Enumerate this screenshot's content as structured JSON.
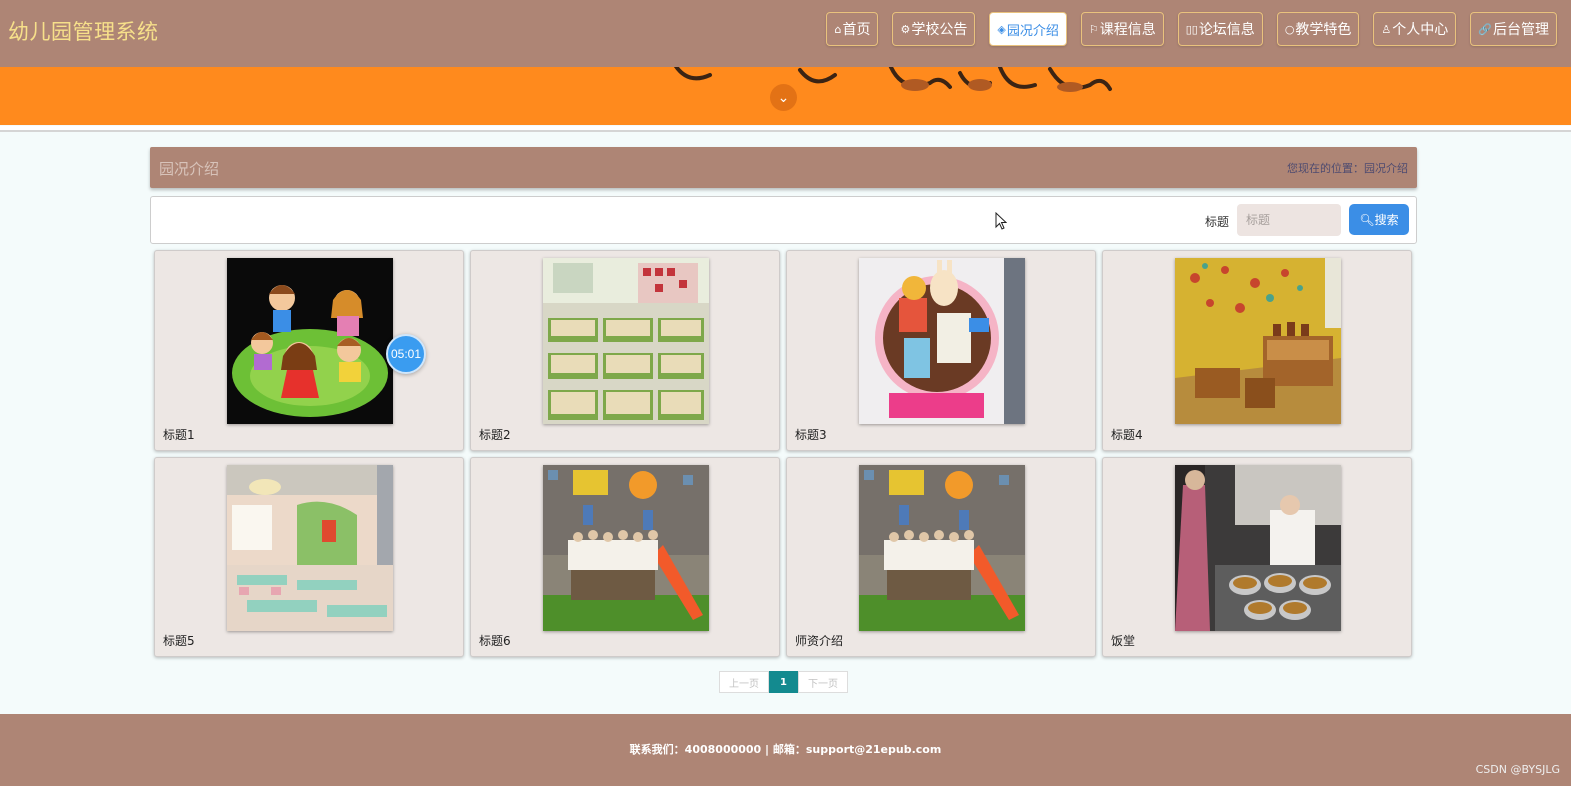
{
  "brand": "幼儿园管理系统",
  "nav": [
    {
      "icon": "home-icon",
      "glyph": "⌂",
      "label": "首页"
    },
    {
      "icon": "gear-icon",
      "glyph": "⚙",
      "label": "学校公告"
    },
    {
      "icon": "layers-icon",
      "glyph": "◈",
      "label": "园况介绍"
    },
    {
      "icon": "flag-icon",
      "glyph": "⚐",
      "label": "课程信息"
    },
    {
      "icon": "chat-icon",
      "glyph": "▯▯",
      "label": "论坛信息"
    },
    {
      "icon": "circle-icon",
      "glyph": "○",
      "label": "教学特色"
    },
    {
      "icon": "user-icon",
      "glyph": "♙",
      "label": "个人中心"
    },
    {
      "icon": "link-icon",
      "glyph": "🔗",
      "label": "后台管理"
    }
  ],
  "active_nav": "园况介绍",
  "page_title": "园况介绍",
  "breadcrumb": "您现在的位置：园况介绍",
  "search": {
    "label": "标题",
    "placeholder": "标题",
    "button": "搜索"
  },
  "timer": "05:01",
  "cards": [
    {
      "title": "标题1",
      "image": "children-dancing-illustration"
    },
    {
      "title": "标题2",
      "image": "nap-room-beds"
    },
    {
      "title": "标题3",
      "image": "wall-decoration-board"
    },
    {
      "title": "标题4",
      "image": "yellow-classroom"
    },
    {
      "title": "标题5",
      "image": "dining-room-tables"
    },
    {
      "title": "标题6",
      "image": "group-photo-playground"
    },
    {
      "title": "师资介绍",
      "image": "group-photo-playground"
    },
    {
      "title": "饭堂",
      "image": "kitchen-staff-cooking"
    }
  ],
  "pager": {
    "prev": "上一页",
    "current": "1",
    "next": "下一页"
  },
  "footer": "联系我们：4008000000 | 邮箱：support@21epub.com",
  "watermark": "CSDN @BYSJLG",
  "colors": {
    "header": "#ae8575",
    "banner": "#ff8a1d",
    "accent": "#3b8ee6",
    "brand_text": "#f7e08a",
    "pager_active": "#138a8f"
  }
}
